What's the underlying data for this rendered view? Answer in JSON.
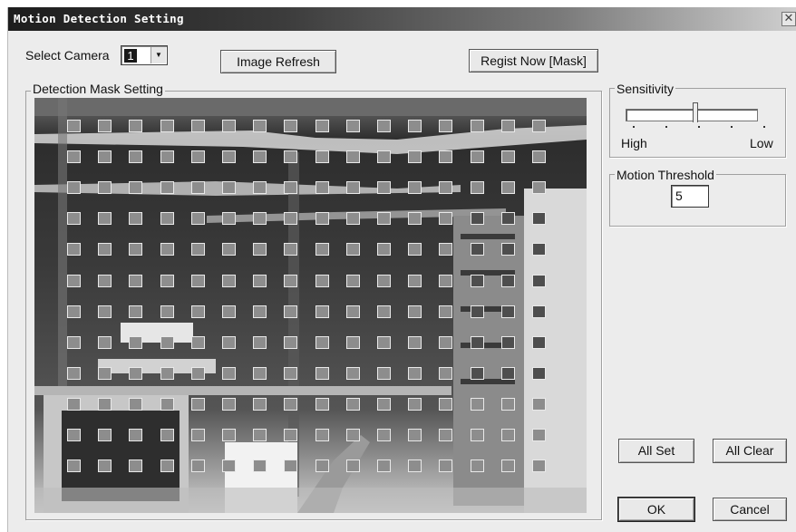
{
  "window": {
    "title": "Motion Detection Setting",
    "close_glyph": "✕"
  },
  "camera_select": {
    "label": "Select Camera",
    "value": "1",
    "arrow_icon": "chevron-down-icon"
  },
  "buttons": {
    "image_refresh": "Image Refresh",
    "regist_now": "Regist Now [Mask]",
    "all_set": "All Set",
    "all_clear": "All Clear",
    "ok": "OK",
    "cancel": "Cancel"
  },
  "mask_group": {
    "label": "Detection Mask Setting",
    "rows": 12,
    "cols": 16
  },
  "sensitivity": {
    "label": "Sensitivity",
    "high_label": "High",
    "low_label": "Low",
    "level": 0.5
  },
  "threshold": {
    "label": "Motion Threshold",
    "value": "5"
  }
}
